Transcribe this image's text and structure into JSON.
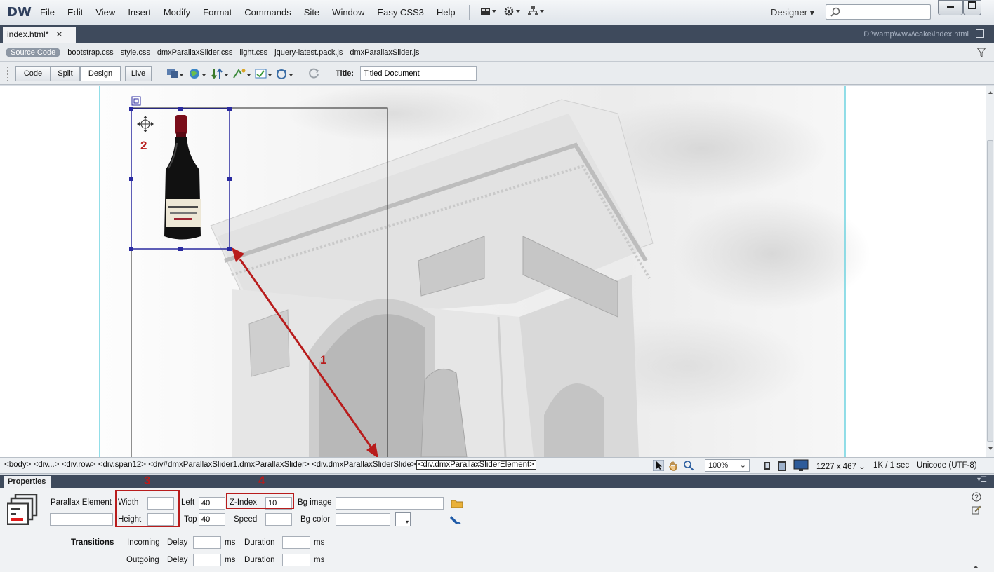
{
  "app": {
    "logo": "DW"
  },
  "menu": [
    "File",
    "Edit",
    "View",
    "Insert",
    "Modify",
    "Format",
    "Commands",
    "Site",
    "Window",
    "Easy CSS3",
    "Help"
  ],
  "workspace": {
    "label": "Designer ▾"
  },
  "doc_tab": {
    "name": "index.html*",
    "close": "✕",
    "path": "D:\\wamp\\www\\cake\\index.html"
  },
  "related_files": {
    "source_code": "Source Code",
    "files": [
      "bootstrap.css",
      "style.css",
      "dmxParallaxSlider.css",
      "light.css",
      "jquery-latest.pack.js",
      "dmxParallaxSlider.js"
    ]
  },
  "doc_toolbar": {
    "views": [
      "Code",
      "Split",
      "Design",
      "Live"
    ],
    "active_view": "Design",
    "title_label": "Title:",
    "title_value": "Titled Document"
  },
  "annotations": {
    "n1": "1",
    "n2": "2",
    "n3": "3",
    "n4": "4"
  },
  "tag_selector": {
    "path": "<body> <div...> <div.row> <div.span12> <div#dmxParallaxSlider1.dmxParallaxSlider> <div.dmxParallaxSliderSlide>",
    "current": "<div.dmxParallaxSliderElement>"
  },
  "status": {
    "zoom": "100%",
    "window_size": "1227 x 467",
    "download": "1K / 1 sec",
    "encoding": "Unicode (UTF-8)"
  },
  "properties": {
    "tab": "Properties",
    "element_label": "Parallax Element",
    "width_label": "Width",
    "width_value": "",
    "height_label": "Height",
    "height_value": "",
    "left_label": "Left",
    "left_value": "40",
    "top_label": "Top",
    "top_value": "40",
    "zindex_label": "Z-Index",
    "zindex_value": "10",
    "speed_label": "Speed",
    "speed_value": "",
    "bgimage_label": "Bg image",
    "bgimage_value": "",
    "bgcolor_label": "Bg color",
    "bgcolor_value": "",
    "transitions_label": "Transitions",
    "incoming_label": "Incoming",
    "outgoing_label": "Outgoing",
    "delay_label": "Delay",
    "duration_label": "Duration",
    "ms": "ms"
  },
  "colors": {
    "annotation": "#b81c1c",
    "selection": "#2a2aa0",
    "guides": "#6fd3e0"
  }
}
